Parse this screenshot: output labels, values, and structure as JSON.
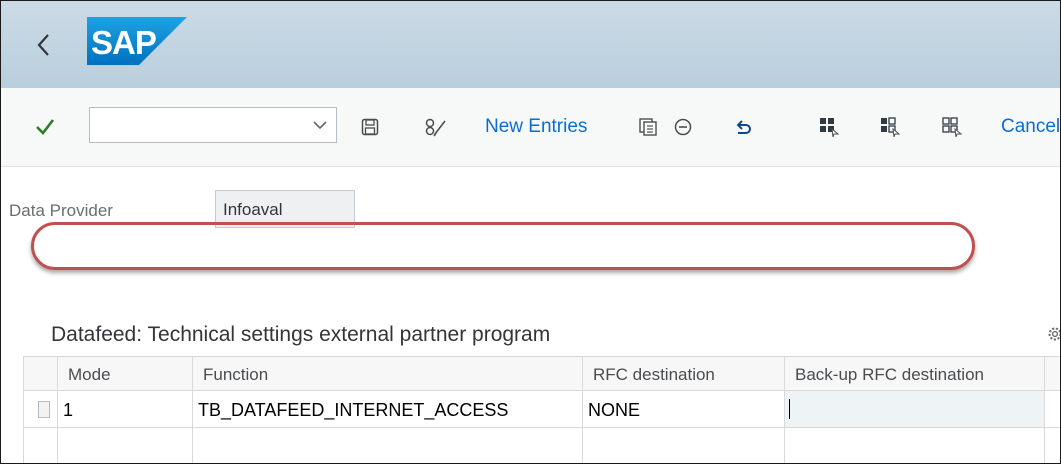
{
  "shell": {
    "back_icon": "chevron-left-icon",
    "logo_text": "SAP",
    "brand_color": "#0070c0"
  },
  "toolbar": {
    "command_field_value": "",
    "new_entries_label": "New Entries",
    "cancel_label": "Cancel",
    "accent_color": "#0a6ed1",
    "icons": [
      "checkmark-icon",
      "save-icon",
      "edit-glasses-icon",
      "copy-icon",
      "delete-icon",
      "undo-icon",
      "select-all-icon",
      "select-block-icon",
      "deselect-all-icon"
    ]
  },
  "form": {
    "data_provider_label": "Data Provider",
    "data_provider_value": "Infoaval"
  },
  "table": {
    "title": "Datafeed: Technical settings external partner program",
    "columns": [
      "Mode",
      "Function",
      "RFC destination",
      "Back-up RFC destination"
    ],
    "rows": [
      {
        "mode": "1",
        "function": "TB_DATAFEED_INTERNET_ACCESS",
        "rfc_destination": "NONE",
        "backup_rfc_destination": ""
      }
    ]
  },
  "annotation": {
    "highlight_color": "#c0504d"
  }
}
